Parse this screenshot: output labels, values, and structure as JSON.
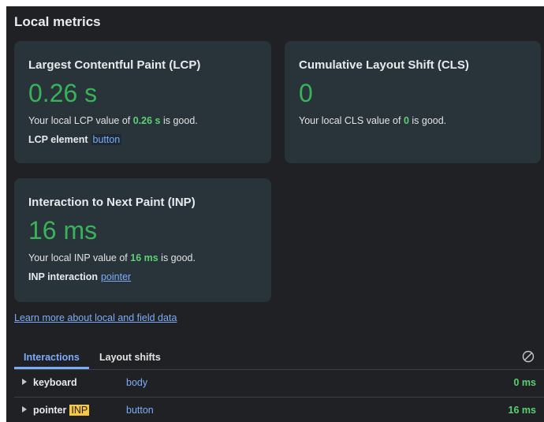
{
  "section_title": "Local metrics",
  "lcp": {
    "title": "Largest Contentful Paint (LCP)",
    "value": "0.26 s",
    "desc_prefix": "Your local LCP value of ",
    "desc_value": "0.26 s",
    "desc_suffix": " is good.",
    "element_label": "LCP element",
    "element_value": "button"
  },
  "cls": {
    "title": "Cumulative Layout Shift (CLS)",
    "value": "0",
    "desc_prefix": "Your local CLS value of ",
    "desc_value": "0",
    "desc_suffix": " is good."
  },
  "inp": {
    "title": "Interaction to Next Paint (INP)",
    "value": "16 ms",
    "desc_prefix": "Your local INP value of ",
    "desc_value": "16 ms",
    "desc_suffix": " is good.",
    "interaction_label": "INP interaction",
    "interaction_value": "pointer"
  },
  "learn_more": "Learn more about local and field data",
  "tabs": [
    {
      "label": "Interactions",
      "active": true
    },
    {
      "label": "Layout shifts",
      "active": false
    }
  ],
  "interactions": [
    {
      "type": "keyboard",
      "badge": "",
      "element": "body",
      "duration": "0 ms"
    },
    {
      "type": "pointer",
      "badge": "INP",
      "element": "button",
      "duration": "16 ms"
    }
  ],
  "colors": {
    "good": "#39b35a",
    "link": "#7cacf8",
    "badge": "#f9c740",
    "card": "#28333a",
    "panel": "#202124"
  },
  "icons": {
    "clear": "block-icon",
    "expand": "triangle-right-icon"
  }
}
